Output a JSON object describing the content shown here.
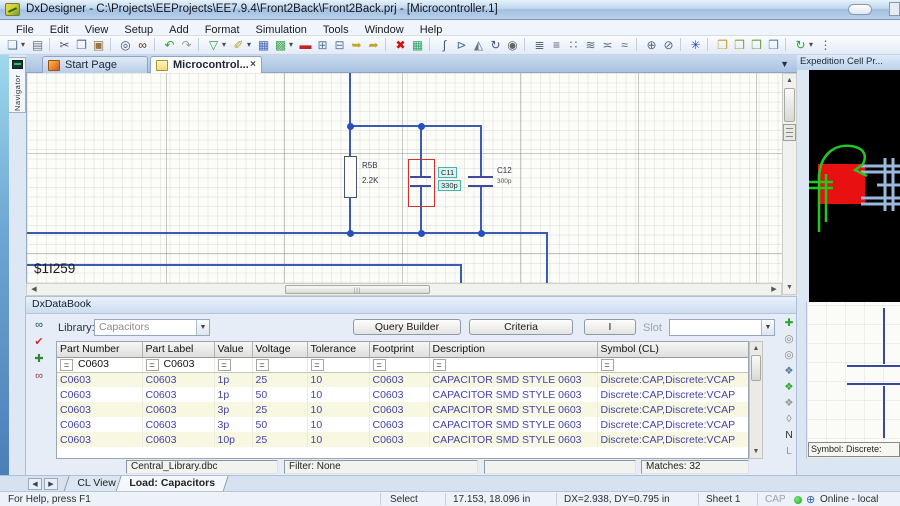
{
  "window": {
    "title": "DxDesigner - C:\\Projects\\EEProjects\\EE7.9.4\\Front2Back\\Front2Back.prj - [Microcontroller.1]"
  },
  "menu": {
    "items": [
      "File",
      "Edit",
      "View",
      "Setup",
      "Add",
      "Format",
      "Simulation",
      "Tools",
      "Window",
      "Help"
    ]
  },
  "toolbar": {
    "icons": [
      {
        "name": "new-icon",
        "glyph": "❏",
        "color": "#55779a"
      },
      {
        "caret": true
      },
      {
        "name": "print-icon",
        "glyph": "▤",
        "color": "#667788"
      },
      {
        "sep": true
      },
      {
        "name": "cut-icon",
        "glyph": "✂",
        "color": "#445577"
      },
      {
        "name": "copy-icon",
        "glyph": "❐",
        "color": "#556699"
      },
      {
        "name": "paste-icon",
        "glyph": "▣",
        "color": "#997744"
      },
      {
        "sep": true
      },
      {
        "name": "zoom-icon",
        "glyph": "◎",
        "color": "#445577"
      },
      {
        "name": "find-icon",
        "glyph": "∞",
        "color": "#553311"
      },
      {
        "sep": true
      },
      {
        "name": "undo-icon",
        "glyph": "↶",
        "color": "#2fa32f"
      },
      {
        "name": "redo-icon",
        "glyph": "↷",
        "color": "#999999"
      },
      {
        "sep": true
      },
      {
        "name": "select-mode-icon",
        "glyph": "▽",
        "color": "#2fa344"
      },
      {
        "caret": true
      },
      {
        "name": "draw-mode-icon",
        "glyph": "✐",
        "color": "#b3a322"
      },
      {
        "caret": true
      },
      {
        "name": "grid-icon",
        "glyph": "▦",
        "color": "#4466bb"
      },
      {
        "name": "image-icon",
        "glyph": "▩",
        "color": "#44a355"
      },
      {
        "caret": true
      },
      {
        "name": "block-icon",
        "glyph": "▬",
        "color": "#c22222"
      },
      {
        "name": "sheet-add-icon",
        "glyph": "⊞",
        "color": "#557799"
      },
      {
        "name": "sheet-remove-icon",
        "glyph": "⊟",
        "color": "#557799"
      },
      {
        "name": "import-icon",
        "glyph": "➥",
        "color": "#c2a322"
      },
      {
        "name": "export-icon",
        "glyph": "➦",
        "color": "#c2a322"
      },
      {
        "sep": true
      },
      {
        "name": "delete-icon",
        "glyph": "✖",
        "color": "#d11111"
      },
      {
        "name": "part-lister-icon",
        "glyph": "▦",
        "color": "#2fa366"
      },
      {
        "sep": true
      },
      {
        "name": "net-icon",
        "glyph": "∫",
        "color": "#445577"
      },
      {
        "name": "bus-icon",
        "glyph": "⊳",
        "color": "#447788"
      },
      {
        "name": "mirror-icon",
        "glyph": "◭",
        "color": "#667788"
      },
      {
        "name": "rotate-icon",
        "glyph": "↻",
        "color": "#445577"
      },
      {
        "name": "find-part-icon",
        "glyph": "◉",
        "color": "#666666"
      },
      {
        "sep": true
      },
      {
        "name": "align-top-icon",
        "glyph": "≣",
        "color": "#556677"
      },
      {
        "name": "align-middle-icon",
        "glyph": "≡",
        "color": "#556677"
      },
      {
        "name": "align-bottom-icon",
        "glyph": "∷",
        "color": "#556677"
      },
      {
        "name": "align-left-icon",
        "glyph": "≋",
        "color": "#556677"
      },
      {
        "name": "align-center-icon",
        "glyph": "≍",
        "color": "#556677"
      },
      {
        "name": "align-right-icon",
        "glyph": "≈",
        "color": "#556677"
      },
      {
        "sep": true
      },
      {
        "name": "group-icon",
        "glyph": "⊕",
        "color": "#556677"
      },
      {
        "name": "ungroup-icon",
        "glyph": "⊘",
        "color": "#556677"
      },
      {
        "sep": true
      },
      {
        "name": "snap-icon",
        "glyph": "✳",
        "color": "#2244cc"
      },
      {
        "sep": true
      },
      {
        "name": "push-block-icon",
        "glyph": "❒",
        "color": "#bba333"
      },
      {
        "name": "pop-block-icon",
        "glyph": "❒",
        "color": "#88a333"
      },
      {
        "name": "push-sheet-icon",
        "glyph": "❒",
        "color": "#66a344"
      },
      {
        "name": "pop-sheet-icon",
        "glyph": "❒",
        "color": "#5588aa"
      },
      {
        "sep": true
      },
      {
        "name": "sync-icon",
        "glyph": "↻",
        "color": "#2fa32f"
      },
      {
        "caret": true
      },
      {
        "name": "toolbar-overflow-icon",
        "glyph": "⋮",
        "color": "#556677"
      }
    ]
  },
  "navigator": {
    "label": "Navigator"
  },
  "tabs": {
    "start_page": "Start Page",
    "active_doc": "Microcontrol...",
    "close_glyph": "×",
    "overflow_glyph": "▼"
  },
  "schematic": {
    "net_label": "$1I259",
    "resistor": {
      "ref": "R5B",
      "value": "2.2K"
    },
    "c11": {
      "ref": "C11",
      "value": "330p"
    },
    "c12": {
      "ref": "C12",
      "value": "300p"
    }
  },
  "expedition": {
    "title": "Expedition Cell Pr...",
    "symbol_caption": "Symbol: Discrete:"
  },
  "databook": {
    "title": "DxDataBook",
    "library_label": "Library:",
    "library_value": "Capacitors",
    "query_builder_label": "Query Builder",
    "criteria_label": "Criteria",
    "i_button_label": "I",
    "slot_label": "Slot",
    "left_icons": [
      {
        "name": "find-parts-icon",
        "glyph": "∞",
        "color": "#0d5555"
      },
      {
        "name": "verify-icon",
        "glyph": "✔",
        "color": "#c23333"
      },
      {
        "name": "place-part-icon",
        "glyph": "✚",
        "color": "#2f8833"
      },
      {
        "name": "search-db-icon",
        "glyph": "∞",
        "color": "#993333"
      }
    ],
    "right_icons": [
      {
        "name": "add-symbol-icon",
        "glyph": "✚",
        "color": "#2fa32f"
      },
      {
        "name": "pin-view-icon",
        "glyph": "◎",
        "color": "#888888"
      },
      {
        "name": "pin-edit-icon",
        "glyph": "◎",
        "color": "#888888"
      },
      {
        "name": "symbol-swap-icon",
        "glyph": "❖",
        "color": "#557799"
      },
      {
        "name": "symbol-update-icon",
        "glyph": "❖",
        "color": "#2fa32f"
      },
      {
        "name": "symbol-gray-icon",
        "glyph": "❖",
        "color": "#999999"
      },
      {
        "name": "eraser-icon",
        "glyph": "◊",
        "color": "#888888"
      },
      {
        "name": "net-assign-icon",
        "glyph": "N",
        "color": "#333333"
      },
      {
        "name": "label-assign-icon",
        "glyph": "L",
        "color": "#999999"
      }
    ],
    "table": {
      "eq": "=",
      "headers": [
        "Part Number",
        "Part Label",
        "Value",
        "Voltage",
        "Tolerance",
        "Footprint",
        "Description",
        "Symbol (CL)"
      ],
      "filter": [
        "C0603",
        "C0603",
        "",
        "",
        "",
        "",
        "",
        ""
      ],
      "rows": [
        [
          "C0603",
          "C0603",
          "1p",
          "25",
          "10",
          "C0603",
          "CAPACITOR SMD STYLE 0603",
          "Discrete:CAP,Discrete:VCAP"
        ],
        [
          "C0603",
          "C0603",
          "1p",
          "50",
          "10",
          "C0603",
          "CAPACITOR SMD STYLE 0603",
          "Discrete:CAP,Discrete:VCAP"
        ],
        [
          "C0603",
          "C0603",
          "3p",
          "25",
          "10",
          "C0603",
          "CAPACITOR SMD STYLE 0603",
          "Discrete:CAP,Discrete:VCAP"
        ],
        [
          "C0603",
          "C0603",
          "3p",
          "50",
          "10",
          "C0603",
          "CAPACITOR SMD STYLE 0603",
          "Discrete:CAP,Discrete:VCAP"
        ],
        [
          "C0603",
          "C0603",
          "10p",
          "25",
          "10",
          "C0603",
          "CAPACITOR SMD STYLE 0603",
          "Discrete:CAP,Discrete:VCAP"
        ]
      ]
    },
    "footer": {
      "library_file": "Central_Library.dbc",
      "filter": "Filter: None",
      "matches": "Matches: 32"
    }
  },
  "bottom_tabs": {
    "cl_view": "CL View",
    "load": "Load: Capacitors"
  },
  "status": {
    "help": "For Help, press F1",
    "mode": "Select",
    "coords": "17.153, 18.096 in",
    "delta": "DX=2.938, DY=0.795 in",
    "sheet": "Sheet 1",
    "cap": "CAP",
    "online": "Online - local"
  }
}
